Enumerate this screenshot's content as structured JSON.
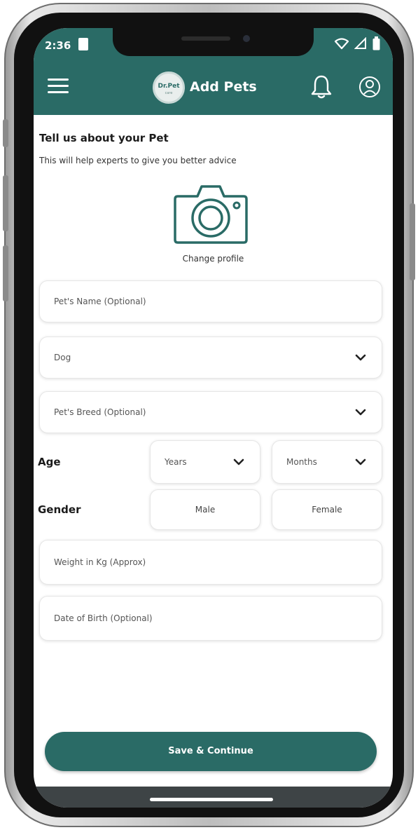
{
  "status_bar": {
    "time": "2:36"
  },
  "header": {
    "logo_text": "Dr.Pet",
    "logo_sub": "care",
    "title": "Add Pets"
  },
  "intro": {
    "title": "Tell us about your Pet",
    "subtitle": "This will help experts to give you better advice",
    "change_profile": "Change profile"
  },
  "form": {
    "pet_name_placeholder": "Pet's Name (Optional)",
    "species_value": "Dog",
    "breed_placeholder": "Pet's Breed (Optional)",
    "age_label": "Age",
    "years_placeholder": "Years",
    "months_placeholder": "Months",
    "gender_label": "Gender",
    "male_label": "Male",
    "female_label": "Female",
    "weight_placeholder": "Weight in Kg (Approx)",
    "dob_placeholder": "Date of Birth (Optional)"
  },
  "actions": {
    "save_label": "Save & Continue"
  },
  "colors": {
    "primary": "#2a6b66",
    "background": "#ffffff"
  }
}
